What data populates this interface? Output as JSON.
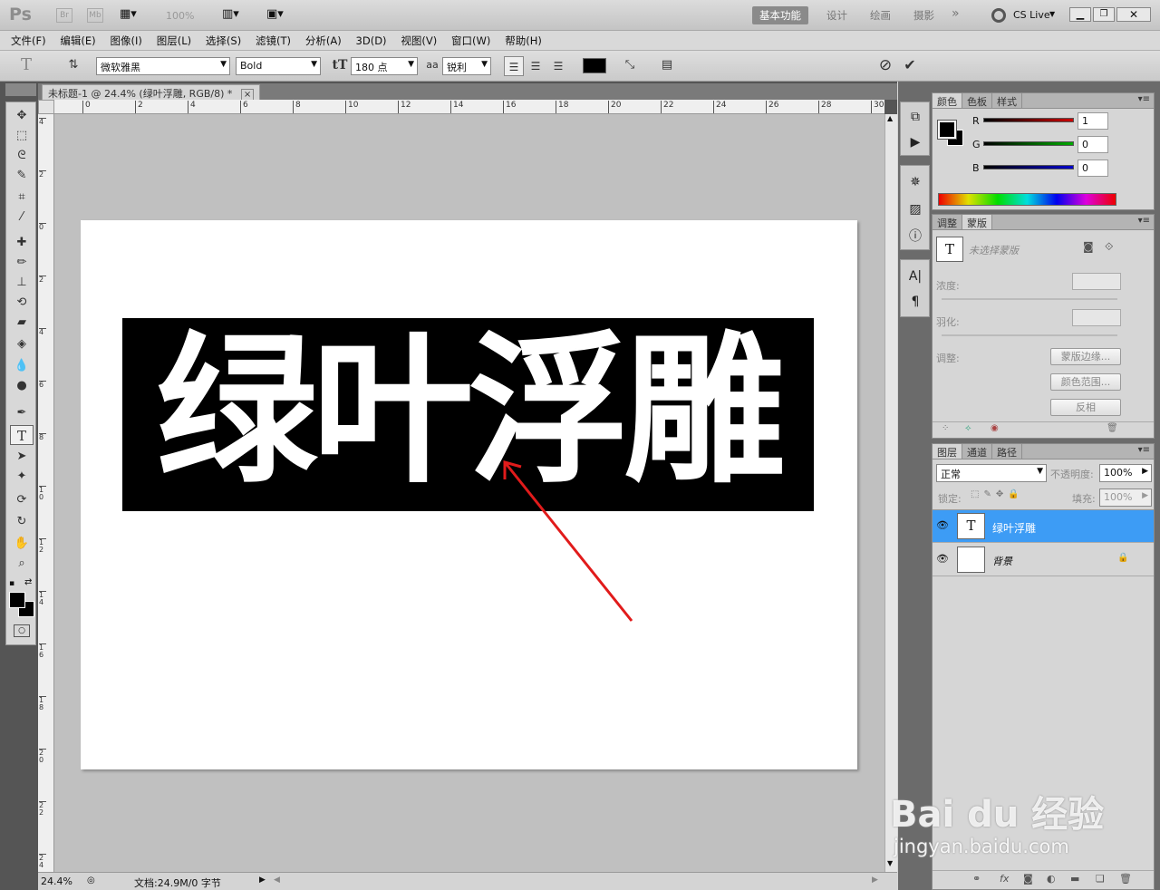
{
  "app": {
    "logo": "Ps",
    "bridge_btn": "Br",
    "minibridge_btn": "Mb",
    "zoom_value": "100%",
    "workspaces": [
      "基本功能",
      "设计",
      "绘画",
      "摄影"
    ],
    "more": "»",
    "cs_live": "CS Live",
    "window_controls": [
      "minimize",
      "restore",
      "close"
    ]
  },
  "menu": [
    "文件(F)",
    "编辑(E)",
    "图像(I)",
    "图层(L)",
    "选择(S)",
    "滤镜(T)",
    "分析(A)",
    "3D(D)",
    "视图(V)",
    "窗口(W)",
    "帮助(H)"
  ],
  "options": {
    "tool_glyph": "T",
    "font_family": "微软雅黑",
    "font_style": "Bold",
    "font_size": "180 点",
    "aa_label": "aa",
    "anti_alias": "锐利",
    "text_color": "#000000",
    "cancel": "⊘",
    "commit": "✔"
  },
  "document": {
    "tab_title": "未标题-1 @ 24.4% (绿叶浮雕, RGB/8) *",
    "tab_close": "×",
    "canvas_text": "绿叶浮雕",
    "ruler_h": [
      "0",
      "2",
      "4",
      "6",
      "8",
      "10",
      "12",
      "14",
      "16",
      "18",
      "20",
      "22",
      "24",
      "26",
      "28",
      "30"
    ],
    "ruler_v": [
      "4",
      "2",
      "0",
      "2",
      "4",
      "6",
      "8",
      "1 0",
      "1 2",
      "1 4",
      "1 6",
      "1 8",
      "2 0",
      "2 2",
      "2 4"
    ]
  },
  "status": {
    "zoom": "24.4%",
    "doc_info": "文档:24.9M/0 字节"
  },
  "color_panel": {
    "tabs": [
      "颜色",
      "色板",
      "样式"
    ],
    "channels": [
      {
        "label": "R",
        "value": "1",
        "color": "#cc0000"
      },
      {
        "label": "G",
        "value": "0",
        "color": "#00aa00"
      },
      {
        "label": "B",
        "value": "0",
        "color": "#0000cc"
      }
    ]
  },
  "mask_panel": {
    "tabs": [
      "调整",
      "蒙版"
    ],
    "no_mask": "未选择蒙版",
    "density_label": "浓度:",
    "feather_label": "羽化:",
    "refine_label": "调整:",
    "buttons": [
      "蒙版边缘...",
      "颜色范围...",
      "反相"
    ]
  },
  "layers_panel": {
    "tabs": [
      "图层",
      "通道",
      "路径"
    ],
    "blend_mode": "正常",
    "opacity_label": "不透明度:",
    "opacity": "100%",
    "lock_label": "锁定:",
    "fill_label": "填充:",
    "fill": "100%",
    "layers": [
      {
        "name": "绿叶浮雕",
        "thumb": "T",
        "selected": true
      },
      {
        "name": "背景",
        "thumb": "",
        "selected": false
      }
    ],
    "footer_icons": [
      "link-icon",
      "fx-icon",
      "mask-icon",
      "adjustment-icon",
      "group-icon",
      "new-layer-icon",
      "trash-icon"
    ],
    "fx_label": "fx"
  },
  "watermark": {
    "brand": "Bai du 经验",
    "url": "jingyan.baidu.com"
  },
  "colors": {
    "selected_layer": "#3d9cf5",
    "arrow": "#e11b1b",
    "active_workspace": "#8a8a8a"
  }
}
